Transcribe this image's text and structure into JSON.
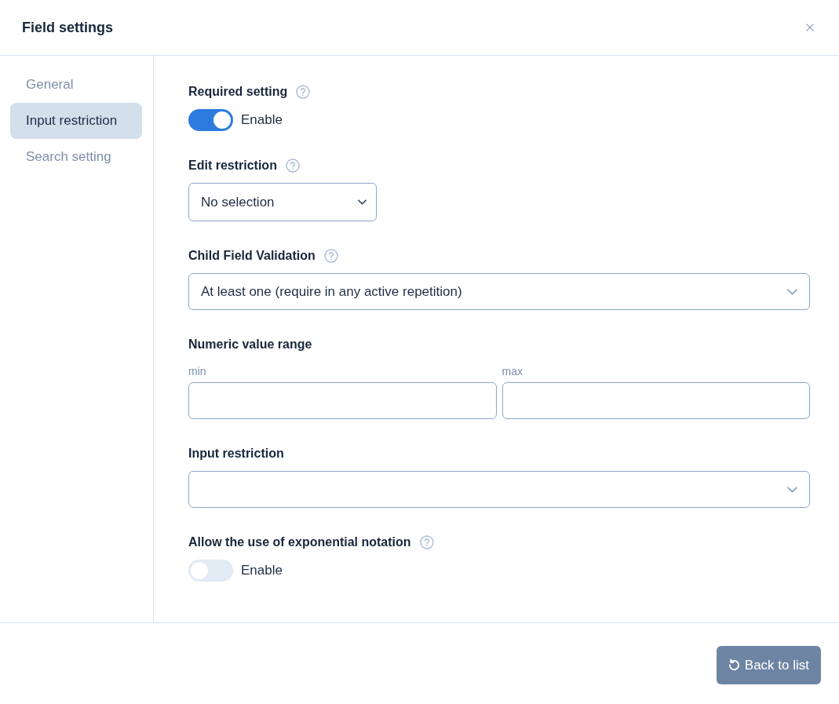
{
  "dialog": {
    "title": "Field settings"
  },
  "sidebar": {
    "items": [
      {
        "label": "General",
        "selected": false
      },
      {
        "label": "Input restriction",
        "selected": true
      },
      {
        "label": "Search setting",
        "selected": false
      }
    ]
  },
  "settings": [
    {
      "kind": "toggle",
      "label": "Required setting",
      "help": true,
      "on": true,
      "option": "Enable"
    },
    {
      "kind": "select",
      "label": "Edit restriction",
      "help": true,
      "value": "No selection"
    },
    {
      "kind": "combobox",
      "label": "Child Field Validation",
      "help": true,
      "value": "At least one (require in any active repetition)"
    },
    {
      "kind": "range",
      "label": "Numeric value range",
      "help": false,
      "fields": [
        {
          "label": "min"
        },
        {
          "label": "max"
        }
      ]
    },
    {
      "kind": "combobox",
      "label": "Input restriction",
      "help": false
    },
    {
      "kind": "toggle",
      "label": "Allow the use of exponential notation",
      "help": true,
      "on": false,
      "option": "Enable"
    }
  ],
  "footer": {
    "button": "Back to list"
  }
}
